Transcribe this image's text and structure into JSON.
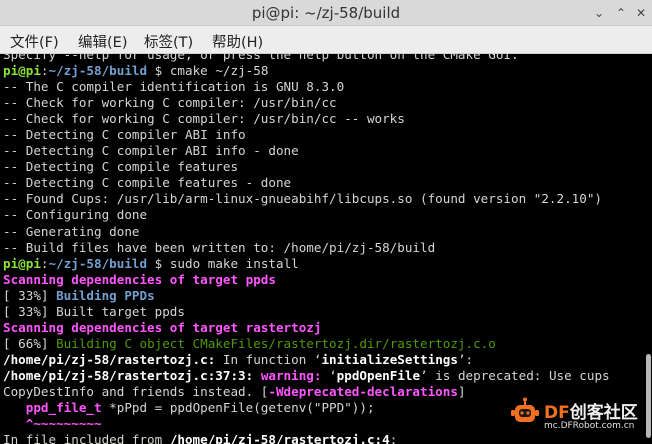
{
  "window": {
    "title": "pi@pi: ~/zj-58/build",
    "minimize_glyph": "⌄",
    "maximize_glyph": "⌃",
    "close_glyph": "✕"
  },
  "menu": {
    "items": [
      "文件(F)",
      "编辑(E)",
      "标签(T)",
      "帮助(H)"
    ]
  },
  "terminal": {
    "lines": [
      [
        {
          "t": "Specify --help for usage, or press the help button on the CMake GUI.",
          "c": ""
        }
      ],
      [
        {
          "t": "pi@pi",
          "c": "green"
        },
        {
          "t": ":",
          "c": ""
        },
        {
          "t": "~/zj-58/build",
          "c": "blue"
        },
        {
          "t": " $ cmake ~/zj-58",
          "c": ""
        }
      ],
      [
        {
          "t": "-- The C compiler identification is GNU 8.3.0",
          "c": ""
        }
      ],
      [
        {
          "t": "-- Check for working C compiler: /usr/bin/cc",
          "c": ""
        }
      ],
      [
        {
          "t": "-- Check for working C compiler: /usr/bin/cc -- works",
          "c": ""
        }
      ],
      [
        {
          "t": "-- Detecting C compiler ABI info",
          "c": ""
        }
      ],
      [
        {
          "t": "-- Detecting C compiler ABI info - done",
          "c": ""
        }
      ],
      [
        {
          "t": "-- Detecting C compile features",
          "c": ""
        }
      ],
      [
        {
          "t": "-- Detecting C compile features - done",
          "c": ""
        }
      ],
      [
        {
          "t": "-- Found Cups: /usr/lib/arm-linux-gnueabihf/libcups.so (found version \"2.2.10\")",
          "c": ""
        }
      ],
      [
        {
          "t": "-- Configuring done",
          "c": ""
        }
      ],
      [
        {
          "t": "-- Generating done",
          "c": ""
        }
      ],
      [
        {
          "t": "-- Build files have been written to: /home/pi/zj-58/build",
          "c": ""
        }
      ],
      [
        {
          "t": "pi@pi",
          "c": "green"
        },
        {
          "t": ":",
          "c": ""
        },
        {
          "t": "~/zj-58/build",
          "c": "blue"
        },
        {
          "t": " $ sudo make install",
          "c": ""
        }
      ],
      [
        {
          "t": "Scanning dependencies of target ppds",
          "c": "magenta"
        }
      ],
      [
        {
          "t": "[ 33%] ",
          "c": ""
        },
        {
          "t": "Building PPDs",
          "c": "blue"
        }
      ],
      [
        {
          "t": "[ 33%] Built target ppds",
          "c": ""
        }
      ],
      [
        {
          "t": "Scanning dependencies of target rastertozj",
          "c": "magenta"
        }
      ],
      [
        {
          "t": "[ 66%] ",
          "c": ""
        },
        {
          "t": "Building C object CMakeFiles/rastertozj.dir/rastertozj.c.o",
          "c": "plain-green"
        }
      ],
      [
        {
          "t": "/home/pi/zj-58/rastertozj.c:",
          "c": "white-b"
        },
        {
          "t": " In function ‘",
          "c": ""
        },
        {
          "t": "initializeSettings",
          "c": "white-b"
        },
        {
          "t": "’:",
          "c": ""
        }
      ],
      [
        {
          "t": "/home/pi/zj-58/rastertozj.c:37:3:",
          "c": "white-b"
        },
        {
          "t": " ",
          "c": ""
        },
        {
          "t": "warning:",
          "c": "warn"
        },
        {
          "t": " ‘",
          "c": ""
        },
        {
          "t": "ppdOpenFile",
          "c": "white-b"
        },
        {
          "t": "’ is deprecated: Use cups",
          "c": ""
        }
      ],
      [
        {
          "t": "CopyDestInfo and friends instead. [",
          "c": ""
        },
        {
          "t": "-Wdeprecated-declarations",
          "c": "warn"
        },
        {
          "t": "]",
          "c": ""
        }
      ],
      [
        {
          "t": "   ",
          "c": ""
        },
        {
          "t": "ppd_file_t",
          "c": "magenta"
        },
        {
          "t": " *pPpd = ppdOpenFile(getenv(\"PPD\"));",
          "c": ""
        }
      ],
      [
        {
          "t": "   ",
          "c": ""
        },
        {
          "t": "^~~~~~~~~~",
          "c": "magenta"
        }
      ],
      [
        {
          "t": "In file included from ",
          "c": ""
        },
        {
          "t": "/home/pi/zj-58/rastertozj.c:4",
          "c": "white-b"
        },
        {
          "t": ":",
          "c": ""
        }
      ]
    ]
  },
  "watermark": {
    "brand_prefix": "DF",
    "brand_suffix": "创客社区",
    "url": "mc.DFRobot.com.cn",
    "accent_color": "#f37021"
  }
}
